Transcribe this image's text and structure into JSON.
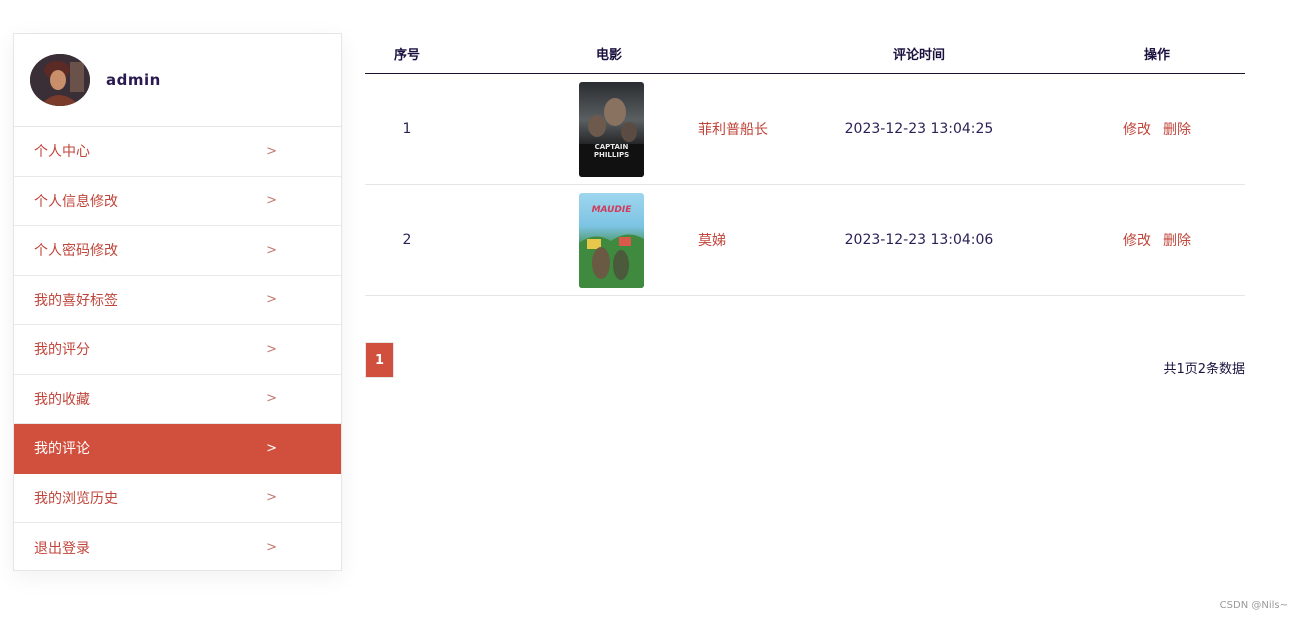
{
  "profile": {
    "username": "admin"
  },
  "sidebar": {
    "items": [
      {
        "label": "个人中心"
      },
      {
        "label": "个人信息修改"
      },
      {
        "label": "个人密码修改"
      },
      {
        "label": "我的喜好标签"
      },
      {
        "label": "我的评分"
      },
      {
        "label": "我的收藏"
      },
      {
        "label": "我的评论"
      },
      {
        "label": "我的浏览历史"
      },
      {
        "label": "退出登录"
      }
    ],
    "active_index": 6,
    "active_color": "#d14f3d",
    "chevron_glyph": ">"
  },
  "table": {
    "headers": {
      "index": "序号",
      "movie": "电影",
      "time": "评论时间",
      "ops": "操作"
    },
    "rows": [
      {
        "index": "1",
        "title": "菲利普船长",
        "poster_text": "CAPTAIN PHILLIPS",
        "time": "2023-12-23 13:04:25",
        "edit": "修改",
        "delete": "删除"
      },
      {
        "index": "2",
        "title": "莫娣",
        "poster_text": "MAUDIE",
        "time": "2023-12-23 13:04:06",
        "edit": "修改",
        "delete": "删除"
      }
    ]
  },
  "pagination": {
    "current_page": "1",
    "summary": "共1页2条数据"
  },
  "watermark": "CSDN @Nils~",
  "colors": {
    "accent": "#d14f3d",
    "link": "#c0453a",
    "text": "#2b1f55"
  }
}
